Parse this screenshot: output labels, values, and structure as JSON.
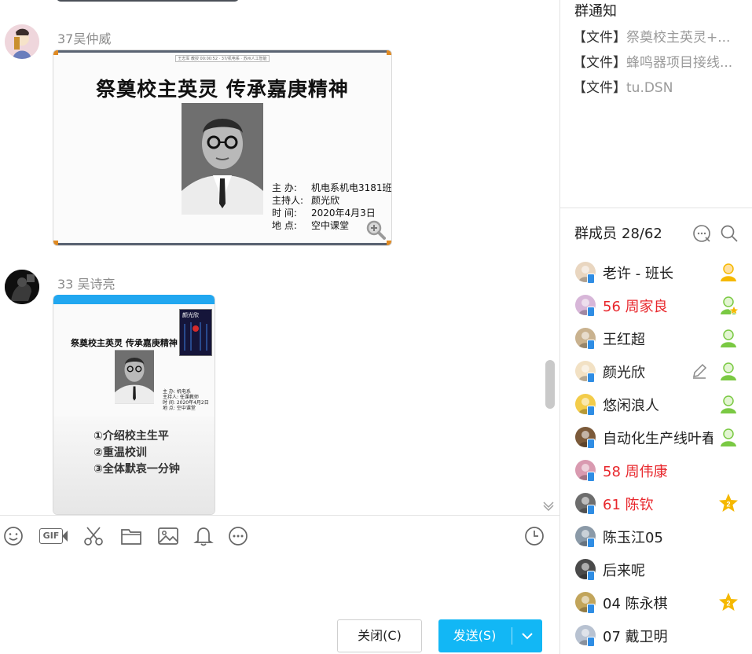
{
  "chat": {
    "messages": [
      {
        "sender": "37吴仲威",
        "slide": {
          "header_strip": "王志军 教授 00:00:52 · 37/机电系 · 苏州人工智能",
          "title": "祭奠校主英灵  传承嘉庚精神",
          "info": [
            {
              "k": "主    办:",
              "v": "机电系机电3181班"
            },
            {
              "k": "主持人:",
              "v": "颜光欣"
            },
            {
              "k": "时    间:",
              "v": "2020年4月3日"
            },
            {
              "k": "地    点:",
              "v": "空中课堂"
            }
          ]
        }
      },
      {
        "sender": "33  吴诗亮",
        "slide": {
          "title": "祭奠校主英灵 传承嘉庚精神",
          "book_label": "颜光欣",
          "info": [
            "主   办:  机电系",
            "主持人:  任课教师",
            "时   间:  2020年4月2日",
            "地   点:  空中课堂"
          ],
          "list": [
            "①介绍校主生平",
            "②重温校训",
            "③全体默哀一分钟"
          ]
        }
      }
    ]
  },
  "toolbar": {
    "icons": [
      "emoji-icon",
      "gif-icon",
      "screenshot-scissors-icon",
      "folder-icon",
      "image-icon",
      "bell-icon",
      "more-icon",
      "history-clock-icon"
    ],
    "gif_label": "GIF"
  },
  "buttons": {
    "close": "关闭(C)",
    "send": "发送(S)"
  },
  "notice": {
    "title": "群通知",
    "items": [
      {
        "tag": "【文件】",
        "name": "祭奠校主英灵+..."
      },
      {
        "tag": "【文件】",
        "name": "蜂鸣器项目接线..."
      },
      {
        "tag": "【文件】",
        "name": "tu.DSN"
      }
    ]
  },
  "members": {
    "title": "群成员",
    "count": "28/62",
    "list": [
      {
        "name": "老许 - 班长",
        "red": false,
        "badge": "owner"
      },
      {
        "name": "56 周家良",
        "red": true,
        "badge": "admin-star"
      },
      {
        "name": "王红超",
        "red": false,
        "badge": "admin"
      },
      {
        "name": "颜光欣",
        "red": false,
        "badge": "admin",
        "edit": true
      },
      {
        "name": "悠闲浪人",
        "red": false,
        "badge": "admin"
      },
      {
        "name": "自动化生产线叶春",
        "red": false,
        "badge": "admin"
      },
      {
        "name": "58 周伟康",
        "red": true,
        "badge": ""
      },
      {
        "name": "61  陈钦",
        "red": true,
        "badge": "level-2"
      },
      {
        "name": "陈玉江05",
        "red": false,
        "badge": ""
      },
      {
        "name": "后来呢",
        "red": false,
        "badge": ""
      },
      {
        "name": "04 陈永棋",
        "red": false,
        "badge": "level-2"
      },
      {
        "name": "07 戴卫明",
        "red": false,
        "badge": ""
      }
    ]
  },
  "colors": {
    "accent": "#12b7f5",
    "red_name": "#e8272c",
    "badge_green": "#7ac943",
    "badge_gold": "#f5b800"
  }
}
